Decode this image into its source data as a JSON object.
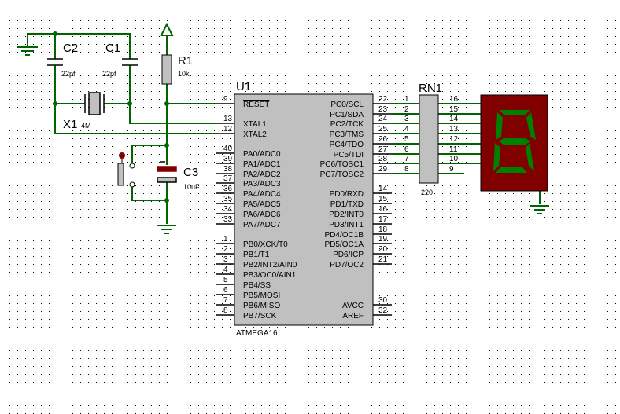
{
  "mcu": {
    "ref": "U1",
    "part": "ATMEGA16",
    "left_pins": [
      {
        "num": "9",
        "name": "RESET"
      },
      {
        "num": "13",
        "name": "XTAL1"
      },
      {
        "num": "12",
        "name": "XTAL2"
      },
      {
        "num": "40",
        "name": "PA0/ADC0"
      },
      {
        "num": "39",
        "name": "PA1/ADC1"
      },
      {
        "num": "38",
        "name": "PA2/ADC2"
      },
      {
        "num": "37",
        "name": "PA3/ADC3"
      },
      {
        "num": "36",
        "name": "PA4/ADC4"
      },
      {
        "num": "35",
        "name": "PA5/ADC5"
      },
      {
        "num": "34",
        "name": "PA6/ADC6"
      },
      {
        "num": "33",
        "name": "PA7/ADC7"
      },
      {
        "num": "1",
        "name": "PB0/XCK/T0"
      },
      {
        "num": "2",
        "name": "PB1/T1"
      },
      {
        "num": "3",
        "name": "PB2/INT2/AIN0"
      },
      {
        "num": "4",
        "name": "PB3/OC0/AIN1"
      },
      {
        "num": "5",
        "name": "PB4/SS"
      },
      {
        "num": "6",
        "name": "PB5/MOSI"
      },
      {
        "num": "7",
        "name": "PB6/MISO"
      },
      {
        "num": "8",
        "name": "PB7/SCK"
      }
    ],
    "right_pins": [
      {
        "num": "22",
        "name": "PC0/SCL"
      },
      {
        "num": "23",
        "name": "PC1/SDA"
      },
      {
        "num": "24",
        "name": "PC2/TCK"
      },
      {
        "num": "25",
        "name": "PC3/TMS"
      },
      {
        "num": "26",
        "name": "PC4/TDO"
      },
      {
        "num": "27",
        "name": "PC5/TDI"
      },
      {
        "num": "28",
        "name": "PC6/TOSC1"
      },
      {
        "num": "29",
        "name": "PC7/TOSC2"
      },
      {
        "num": "14",
        "name": "PD0/RXD"
      },
      {
        "num": "15",
        "name": "PD1/TXD"
      },
      {
        "num": "16",
        "name": "PD2/INT0"
      },
      {
        "num": "17",
        "name": "PD3/INT1"
      },
      {
        "num": "18",
        "name": "PD4/OC1B"
      },
      {
        "num": "19",
        "name": "PD5/OC1A"
      },
      {
        "num": "20",
        "name": "PD6/ICP"
      },
      {
        "num": "21",
        "name": "PD7/OC2"
      },
      {
        "num": "30",
        "name": "AVCC"
      },
      {
        "num": "32",
        "name": "AREF"
      }
    ]
  },
  "components": {
    "c1": {
      "ref": "C1",
      "value": "22pf"
    },
    "c2": {
      "ref": "C2",
      "value": "22pf"
    },
    "c3": {
      "ref": "C3",
      "value": "10uF"
    },
    "r1": {
      "ref": "R1",
      "value": "10k"
    },
    "x1": {
      "ref": "X1",
      "value": "4M"
    },
    "rn1": {
      "ref": "RN1",
      "value": "220",
      "left_pins": [
        "1",
        "2",
        "3",
        "4",
        "5",
        "6",
        "7",
        "8"
      ],
      "right_pins": [
        "16",
        "15",
        "14",
        "13",
        "12",
        "11",
        "10",
        "9"
      ]
    }
  },
  "display": {
    "digit": "8"
  },
  "colors": {
    "wire": "#006400",
    "body_fill": "#c0c0c0",
    "component": "#800000",
    "display_bg": "#800000",
    "segment_on": "#008000",
    "grid_dot": "#000000"
  }
}
